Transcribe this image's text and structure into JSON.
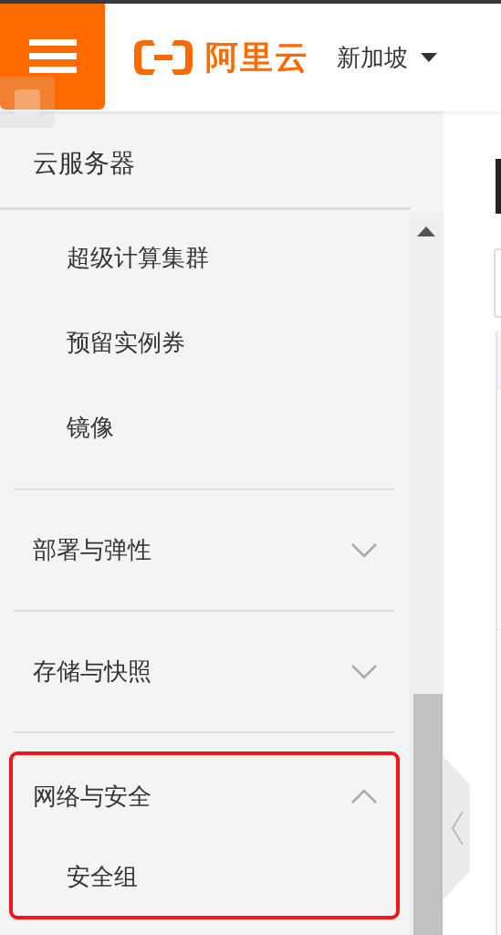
{
  "header": {
    "logo": "阿里云",
    "region": "新加坡"
  },
  "sidebar": {
    "title": "云服务器",
    "items": [
      {
        "label": "超级计算集群"
      },
      {
        "label": "预留实例券"
      },
      {
        "label": "镜像"
      }
    ],
    "groups": [
      {
        "label": "部署与弹性",
        "expanded": false,
        "highlighted": false
      },
      {
        "label": "存储与快照",
        "expanded": false,
        "highlighted": false
      },
      {
        "label": "网络与安全",
        "expanded": true,
        "highlighted": true,
        "children": [
          {
            "label": "安全组"
          }
        ]
      }
    ]
  }
}
